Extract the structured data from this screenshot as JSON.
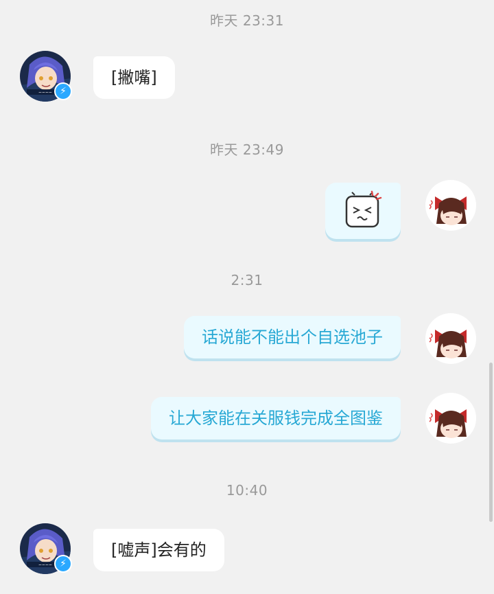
{
  "timestamps": [
    "昨天 23:31",
    "昨天 23:49",
    "2:31",
    "10:40"
  ],
  "messages": [
    {
      "from": "other",
      "text": "[撇嘴]"
    },
    {
      "from": "me",
      "type": "sticker",
      "sticker": "tv-mascot-annoyed"
    },
    {
      "from": "me",
      "text": "话说能不能出个自选池子"
    },
    {
      "from": "me",
      "text": "让大家能在关服钱完成全图鉴"
    },
    {
      "from": "other",
      "text": "[嘘声]会有的"
    }
  ],
  "avatars": {
    "other": {
      "icon": "anime-purple-hair-avatar",
      "badge_icon": "lightning-icon",
      "badge_color": "#2aa8ff"
    },
    "me": {
      "icon": "anime-red-bow-avatar"
    }
  },
  "colors": {
    "background": "#f1f1f1",
    "bubble_left": "#ffffff",
    "bubble_right": "#eafaff",
    "text_right": "#27a8d4",
    "timestamp": "#999999"
  }
}
